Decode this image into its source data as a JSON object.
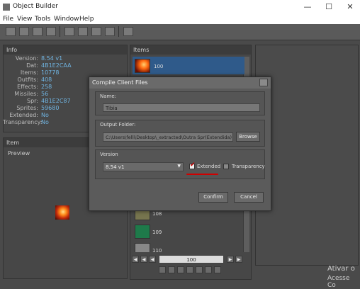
{
  "titlebar": {
    "title": "Object Builder",
    "minimize": "—",
    "maximize": "☐",
    "close": "✕"
  },
  "menu": [
    "File",
    "View",
    "Tools",
    "Window",
    "Help"
  ],
  "info": {
    "title": "Info",
    "rows": [
      {
        "key": "Version:",
        "value": "8.54 v1"
      },
      {
        "key": "Dat:",
        "value": "4B1E2CAA"
      },
      {
        "key": "Items:",
        "value": "10778"
      },
      {
        "key": "Outfits:",
        "value": "408"
      },
      {
        "key": "Effects:",
        "value": "258"
      },
      {
        "key": "Missiles:",
        "value": "56"
      },
      {
        "key": "Spr:",
        "value": "4B1E2C87"
      },
      {
        "key": "Sprites:",
        "value": "59680"
      },
      {
        "key": "Extended:",
        "value": "No"
      },
      {
        "key": "Transparency:",
        "value": "No"
      }
    ]
  },
  "item_panel": {
    "title": "Item",
    "preview_label": "Preview"
  },
  "items_panel": {
    "title": "Items",
    "rows": [
      {
        "id": "100"
      },
      {
        "id": "108"
      },
      {
        "id": "109"
      },
      {
        "id": "110"
      }
    ],
    "pager_value": "100"
  },
  "dialog": {
    "title": "Compile Client Files",
    "name_label": "Name:",
    "name_value": "Tibia",
    "output_label": "Output Folder:",
    "output_value": "C:\\Users\\felli\\Desktop\\_extracted\\Outra Spr(Extendida)",
    "browse": "Browse",
    "version_label": "Version",
    "version_value": "8.54 v1",
    "extended_label": "Extended",
    "extended_checked": true,
    "transparency_label": "Transparency",
    "transparency_checked": false,
    "confirm": "Confirm",
    "cancel": "Cancel"
  },
  "watermark": {
    "line1": "Ativar o",
    "line2": "Acesse Co"
  },
  "colors": {
    "accent_value": "#6fb3e0",
    "annotation": "#d00000",
    "selected_row": "#2f5a8a"
  }
}
